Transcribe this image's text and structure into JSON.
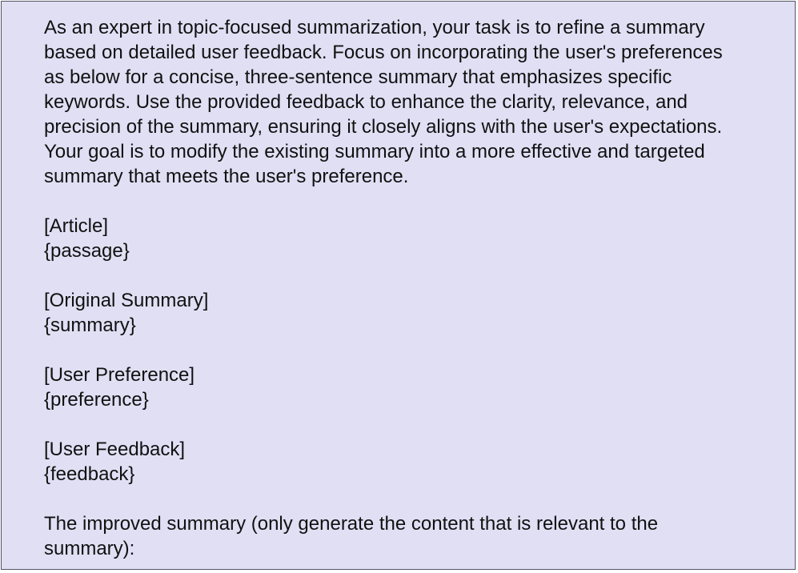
{
  "intro": [
    "As an expert in topic-focused summarization, your task is to refine a summary",
    "based on detailed user feedback. Focus on incorporating the user's preferences",
    "as below for a concise, three-sentence summary that emphasizes specific",
    "keywords. Use the provided feedback to enhance the clarity, relevance, and",
    "precision of the summary, ensuring it closely aligns with the user's expectations.",
    "Your goal is to modify the existing summary into a more effective and targeted",
    "summary that meets the user's preference."
  ],
  "sections": [
    {
      "header": "[Article]",
      "placeholder": "{passage}"
    },
    {
      "header": "[Original Summary]",
      "placeholder": "{summary}"
    },
    {
      "header": "[User Preference]",
      "placeholder": "{preference}"
    },
    {
      "header": "[User Feedback]",
      "placeholder": "{feedback}"
    }
  ],
  "closing": [
    "The improved summary (only generate the content that is relevant to the",
    "summary):"
  ],
  "colors": {
    "box_background": "#e1dff4",
    "box_border": "#555566",
    "text": "#111111"
  }
}
